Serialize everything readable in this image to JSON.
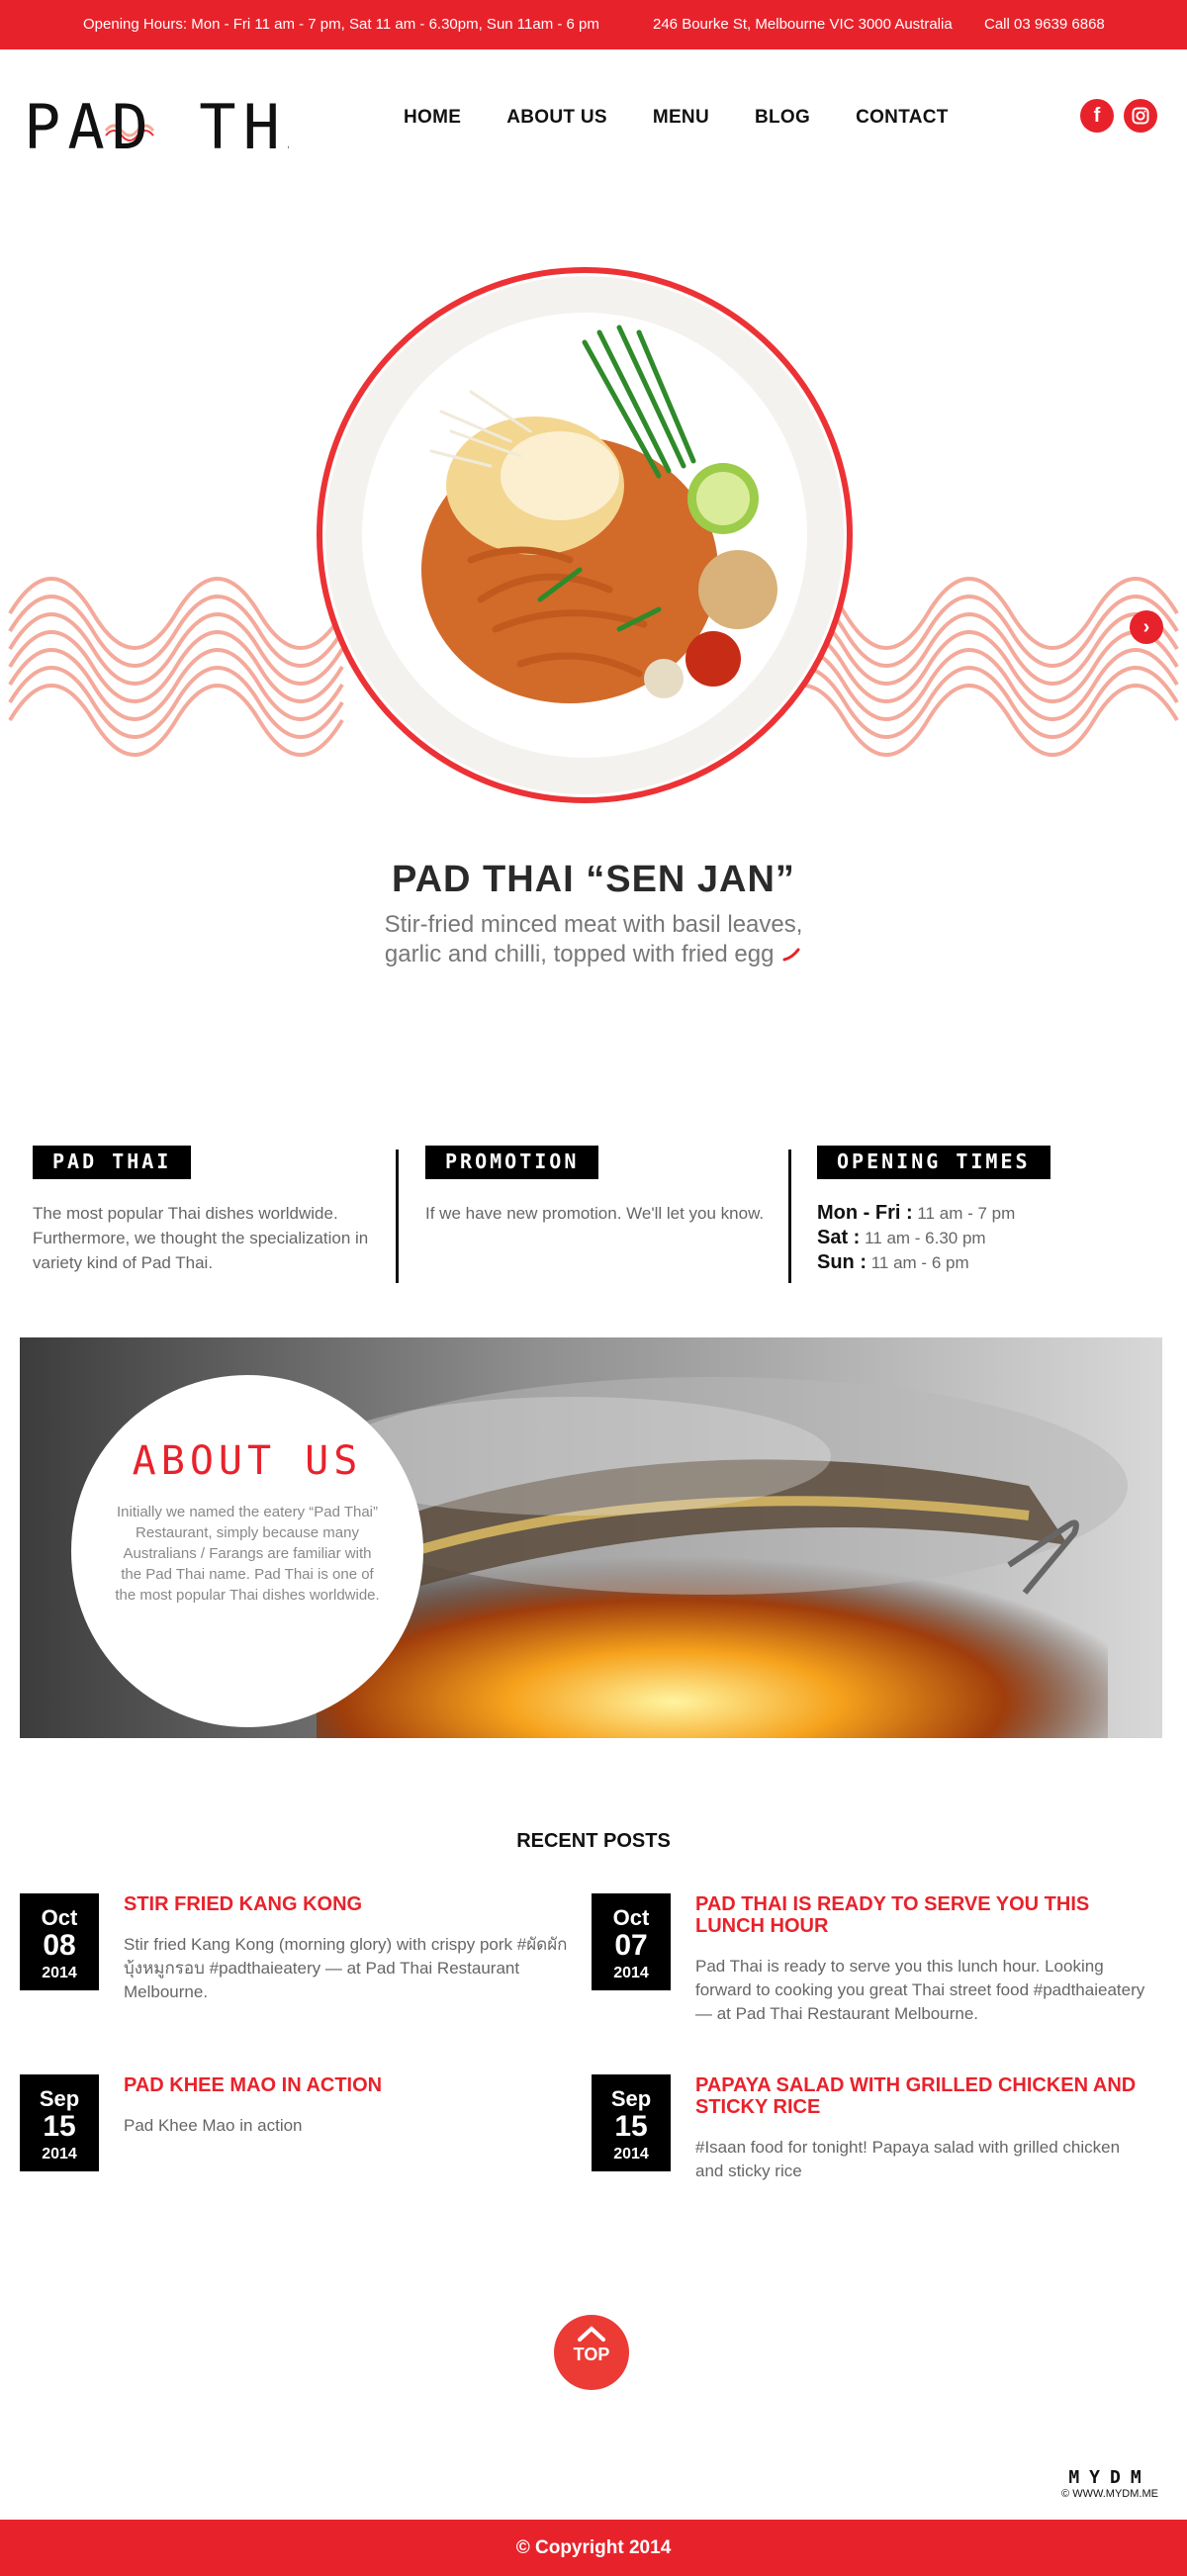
{
  "topbar": {
    "hours": "Opening Hours: Mon - Fri 11 am - 7 pm, Sat 11 am - 6.30pm, Sun 11am - 6 pm",
    "address": "246 Bourke St, Melbourne VIC 3000 Australia",
    "phone": "Call 03 9639 6868"
  },
  "header": {
    "logo": "PAD THAI",
    "nav": [
      "HOME",
      "ABOUT US",
      "MENU",
      "BLOG",
      "CONTACT"
    ],
    "social": {
      "facebook": "f",
      "instagram_icon": "instagram-icon"
    }
  },
  "hero": {
    "title": "PAD THAI “SEN JAN”",
    "subtitle_line1": "Stir-fried minced meat with basil leaves,",
    "subtitle_line2": "garlic and chilli,  topped with fried egg",
    "next_glyph": "›"
  },
  "info": {
    "padthai": {
      "tag": "PAD THAI",
      "text": "The most popular Thai dishes worldwide. Furthermore, we thought the specialization in variety kind of Pad Thai."
    },
    "promotion": {
      "tag": "PROMOTION",
      "text": "If we have new promotion. We'll let you know."
    },
    "opening": {
      "tag": "OPENING TIMES",
      "rows": [
        {
          "day": "Mon - Fri :",
          "time": " 11 am - 7 pm"
        },
        {
          "day": "Sat :",
          "time": " 11 am - 6.30 pm"
        },
        {
          "day": "Sun :",
          "time": " 11 am - 6 pm"
        }
      ]
    }
  },
  "about": {
    "title": "ABOUT US",
    "text": "Initially we named the eatery “Pad Thai” Restaurant, simply because many Australians / Farangs are familiar with the Pad Thai name. Pad Thai is one of the most popular Thai dishes worldwide."
  },
  "recent": {
    "title": "RECENT POSTS",
    "posts": [
      {
        "month": "Oct",
        "day": "08",
        "year": "2014",
        "title": "STIR FRIED KANG KONG",
        "text": "Stir fried Kang Kong (morning glory) with crispy pork #ผัดผักบุ้งหมูกรอบ #padthaieatery — at Pad Thai Restaurant Melbourne."
      },
      {
        "month": "Oct",
        "day": "07",
        "year": "2014",
        "title": "PAD THAI IS READY TO SERVE YOU THIS LUNCH HOUR",
        "text": "Pad Thai is ready to serve you this lunch hour. Looking forward to cooking you great Thai street food #padthaieatery — at Pad Thai Restaurant Melbourne."
      },
      {
        "month": "Sep",
        "day": "15",
        "year": "2014",
        "title": "PAD KHEE MAO IN ACTION",
        "text": "Pad Khee Mao in action"
      },
      {
        "month": "Sep",
        "day": "15",
        "year": "2014",
        "title": "PAPAYA SALAD WITH GRILLED CHICKEN AND STICKY RICE",
        "text": "#Isaan food for tonight! Papaya salad with grilled chicken and sticky rice"
      }
    ]
  },
  "top_button": {
    "label": "TOP"
  },
  "credit": {
    "brand": "MYDM",
    "url": "© WWW.MYDM.ME"
  },
  "footer": {
    "copyright": "© Copyright 2014"
  },
  "colors": {
    "accent": "#e8222b",
    "wave": "#f4a99a",
    "dark": "#000000"
  }
}
